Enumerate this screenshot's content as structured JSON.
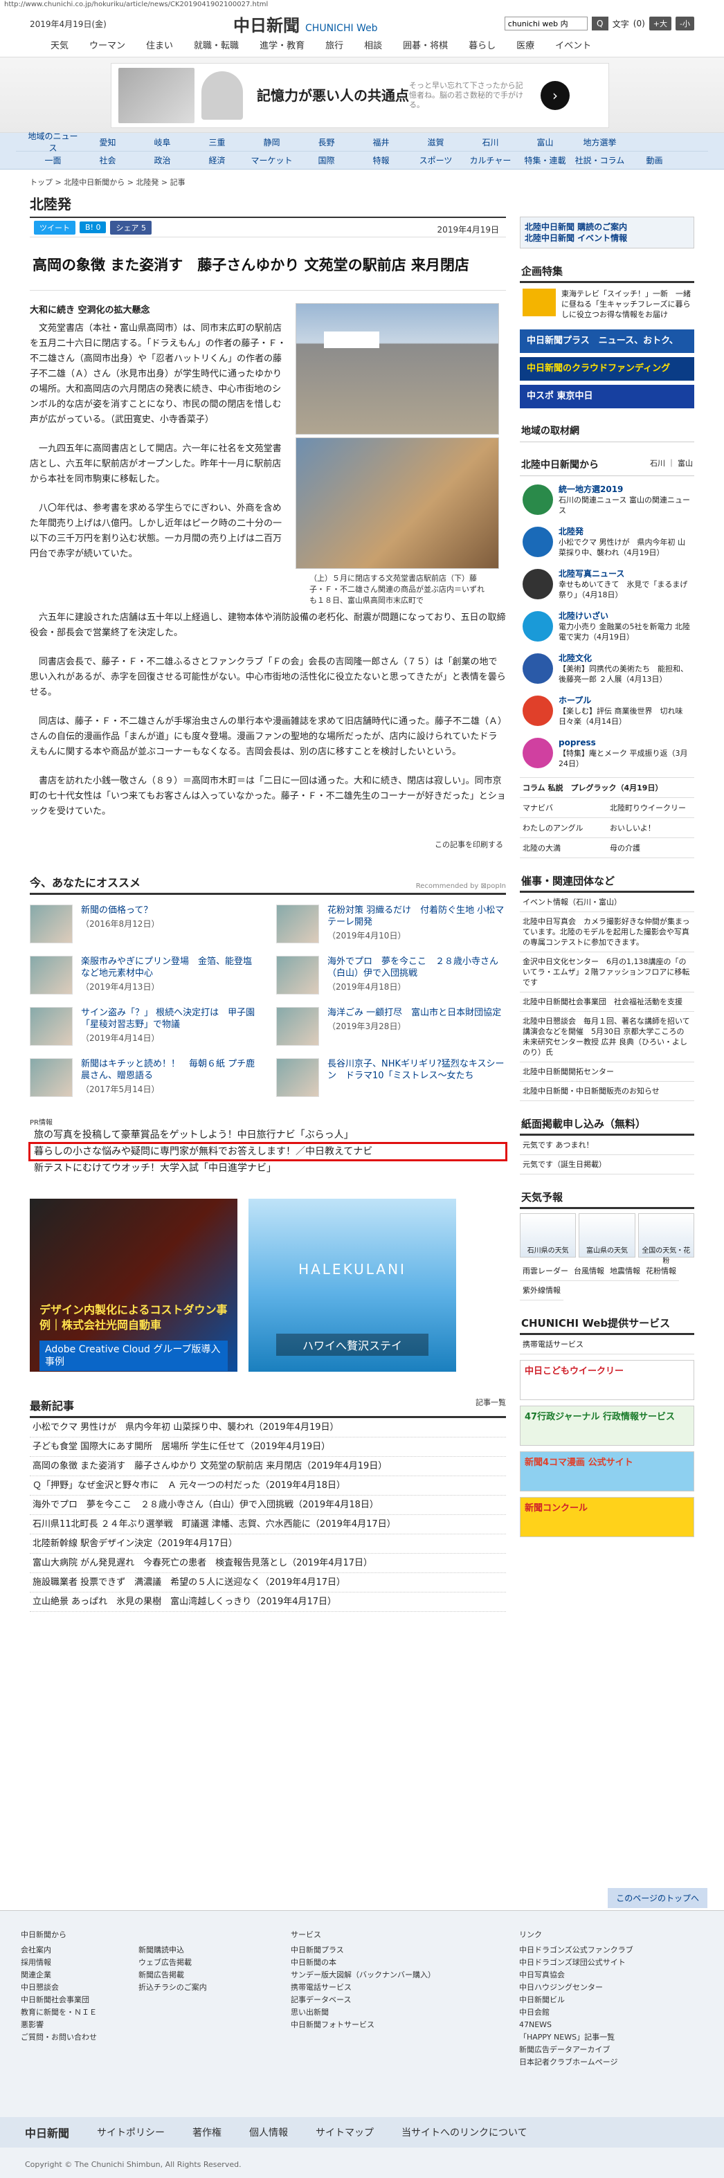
{
  "url": "http://www.chunichi.co.jp/hokuriku/article/news/CK2019041902100027.html",
  "header": {
    "date": "2019年4月19日(金)",
    "logo": "中日新聞",
    "logo_sub": "CHUNICHI Web",
    "search_value": "chunichi web 内",
    "search_icon": "Q",
    "font_label": "文字",
    "font_size_label": "(0)",
    "font_plus": "+大",
    "font_minus": "-小"
  },
  "topnav": [
    "天気",
    "ウーマン",
    "住まい",
    "就職・転職",
    "進学・教育",
    "旅行",
    "相談",
    "囲碁・将棋",
    "暮らし",
    "医療",
    "イベント"
  ],
  "ad_top": {
    "title": "記憶力が悪い人の共通点",
    "sub": "そっと早い忘れて下さったから記憶者ね。脳の若さ数秘的で手がける。"
  },
  "catnav_row1": [
    "地域のニュース",
    "愛知",
    "岐阜",
    "三重",
    "静岡",
    "長野",
    "福井",
    "滋賀",
    "石川",
    "富山",
    "地方選挙"
  ],
  "catnav_row2": [
    "一面",
    "社会",
    "政治",
    "経済",
    "マーケット",
    "国際",
    "特報",
    "スポーツ",
    "カルチャー",
    "特集・連載",
    "社説・コラム",
    "動画"
  ],
  "breadcrumb": "トップ > 北陸中日新聞から > 北陸発 > 記事",
  "section_title": "北陸発",
  "social": {
    "tweet": "ツイート",
    "hatena": "B! 0",
    "share": "シェア 5",
    "pub_date": "2019年4月19日"
  },
  "headline": "高岡の象徴 また姿消す　藤子さんゆかり 文苑堂の駅前店 来月閉店",
  "article": {
    "sub": "大和に続き 空洞化の拡大懸念",
    "p1": "文苑堂書店（本社・富山県高岡市）は、同市末広町の駅前店を五月二十六日に閉店する。「ドラえもん」の作者の藤子・Ｆ・不二雄さん（高岡市出身）や「忍者ハットリくん」の作者の藤子不二雄（Ａ）さん（氷見市出身）が学生時代に通ったゆかりの場所。大和高岡店の六月閉店の発表に続き、中心市街地のシンボル的な店が姿を消すことになり、市民の間の閉店を惜しむ声が広がっている。（武田寛史、小寺香菜子）",
    "p2": "一九四五年に高岡書店として開店。六一年に社名を文苑堂書店とし、六五年に駅前店がオープンした。昨年十一月に駅前店から本社を同市駒東に移転した。",
    "p3": "八〇年代は、参考書を求める学生らでにぎわい、外商を含めた年間売り上げは八億円。しかし近年はピーク時の二十分の一以下の三千万円を割り込む状態。一カ月間の売り上げは二百万円台で赤字が続いていた。",
    "caption": "（上）５月に閉店する文苑堂書店駅前店（下）藤子・Ｆ・不二雄さん関連の商品が並ぶ店内＝いずれも１８日、富山県高岡市末広町で",
    "p4": "六五年に建設された店舗は五十年以上経過し、建物本体や消防設備の老朽化、耐震が問題になっており、五日の取締役会・部長会で営業終了を決定した。",
    "p5": "同書店会長で、藤子・Ｆ・不二雄ふるさとファンクラブ「Ｆの会」会長の吉岡隆一郎さん（７５）は「創業の地で思い入れがあるが、赤字を回復させる可能性がない。中心市街地の活性化に役立たないと思ってきたが」と表情を曇らせる。",
    "p6": "同店は、藤子・Ｆ・不二雄さんが手塚治虫さんの単行本や漫画雑誌を求めて旧店舗時代に通った。藤子不二雄（Ａ）さんの自伝的漫画作品「まんが道」にも度々登場。漫画ファンの聖地的な場所だったが、店内に設けられていたドラえもんに関する本や商品が並ぶコーナーもなくなる。吉岡会長は、別の店に移すことを検討したいという。",
    "p7": "書店を訪れた小銭一敬さん（８９）＝高岡市木町＝は「二日に一回は通った。大和に続き、閉店は寂しい」。同市京町の七十代女性は「いつ来てもお客さんは入っていなかった。藤子・Ｆ・不二雄先生のコーナーが好きだった」とショックを受けていた。",
    "print": "この記事を印刷する"
  },
  "recommend": {
    "title": "今、あなたにオススメ",
    "by": "Recommended by ⊠popIn",
    "items": [
      {
        "title": "新聞の価格って？",
        "date": "（2016年8月12日）"
      },
      {
        "title": "花粉対策 羽織るだけ　付着防ぐ生地 小松マテーレ開発",
        "date": "（2019年4月10日）"
      },
      {
        "title": "楽服市みやぎにプリン登場　金箔、能登塩など地元素材中心",
        "date": "（2019年4月13日）"
      },
      {
        "title": "海外でプロ　夢を今ここ　２８歳小寺さん（白山）伊で入団挑戦",
        "date": "（2019年4月18日）"
      },
      {
        "title": "サイン盗み「？」 根続へ決定打は　甲子園「星稜対習志野」で物議",
        "date": "（2019年4月14日）"
      },
      {
        "title": "海洋ごみ 一顧打尽　富山市と日本財団協定",
        "date": "（2019年3月28日）"
      },
      {
        "title": "新聞はキチッと読め！！　毎朝６紙 プチ鹿晨さん、贈恩語る",
        "date": "（2017年5月14日）"
      },
      {
        "title": "長谷川京子、NHKギリギリ?猛烈なキスシーン　ドラマ10「ミストレス～女たち",
        "date": ""
      }
    ]
  },
  "pr": {
    "label": "PR情報",
    "items": [
      "旅の写真を投稿して豪華賞品をゲットしよう！中日旅行ナビ「ぶらっ人」",
      "暮らしの小さな悩みや疑問に専門家が無料でお答えします！／中日教えてナビ",
      "新テストにむけてウオッチ！大学入試「中日進学ナビ」"
    ]
  },
  "ad_adobe": {
    "t1": "デザイン内製化によるコストダウン事例｜株式会社光岡自動車",
    "t2": "Adobe Creative Cloud グループ版導入事例"
  },
  "ad_hawaii": {
    "t1": "HALEKULANI",
    "t2": "ハワイへ贅沢ステイ"
  },
  "latest": {
    "title": "最新記事",
    "link": "記事一覧",
    "items": [
      "小松でクマ 男性けが　県内今年初 山菜採り中、襲われ（2019年4月19日）",
      "子ども食堂 国際大にあす開所　居場所 学生に任せて（2019年4月19日）",
      "高岡の象徴 また姿消す　藤子さんゆかり 文苑堂の駅前店 来月閉店（2019年4月19日）",
      "Ｑ「押野」なぜ金沢と野々市に　Ａ 元々一つの村だった（2019年4月18日）",
      "海外でプロ　夢を今ここ　２８歳小寺さん（白山）伊で入団挑戦（2019年4月18日）",
      "石川県11北町長 ２４年ぶり選挙戦　町議選 津幡、志賀、穴水西能に（2019年4月17日）",
      "北陸新幹線 駅舎デザイン決定（2019年4月17日）",
      "富山大病院 がん発見遅れ　今春死亡の患者　検査報告見落とし（2019年4月17日）",
      "施設職業者 投票できず　满濃議　希望の５人に送迎なく（2019年4月17日）",
      "立山絶景 あっぱれ　氷見の果樹　富山湾越しくっきり（2019年4月17日）"
    ]
  },
  "side": {
    "subscribe": "北陸中日新聞 購読のご案内",
    "event": "北陸中日新聞 イベント情報",
    "feature_title": "企画特集",
    "feature_item": "東海テレビ「スイッチ！」一新　一緒に昼ねる「生キャッチフレーズに暮らしに役立つお得な情報をお届け",
    "bar1": "中日新聞プラス　ニュース、おトク、",
    "bar2": "中日新聞のクラウドファンディング",
    "bar3": "中スポ 東京中日",
    "local_title": "地域の取材網",
    "from_title": "北陸中日新聞から",
    "from_tabs": "石川 ｜ 富山",
    "news": [
      {
        "head": "統一地方選2019",
        "body": "石川の関連ニュース\n富山の関連ニュース"
      },
      {
        "head": "北陸発",
        "body": "小松でクマ 男性けが　県内今年初 山菜採り中、襲われ（4月19日）"
      },
      {
        "head": "北陸写真ニュース",
        "body": "幸せもめいてきて　氷見で「まるまげ祭り」（4月18日）"
      },
      {
        "head": "北陸けいざい",
        "body": "電力小売り 金融業の5社を新電力 北陸電で実力（4月19日）"
      },
      {
        "head": "北陸文化",
        "body": "【美術】同携代の美術たち　能担和、後藤亮一郎 ２人展（4月13日）"
      },
      {
        "head": "ホープル",
        "body": "【楽しむ】評伝 商業後世界　切れ味 日々楽（4月14日）"
      },
      {
        "head": "popress",
        "body": "【特集】庵とメーク 平成振り返（3月24日）"
      }
    ],
    "col_title": "コラム 私説　プレグラック（4月19日）",
    "cols": [
      "マナビバ",
      "北陸町りウイークリー",
      "わたしのアングル",
      "おいしいよ！",
      "北陸の大満",
      "母の介護"
    ],
    "company_title": "催事・関連団体など",
    "company": [
      "イベント情報（石川・富山）",
      "北陸中日写真会　カメラ撮影好きな仲間が集まっています。北陸のモデルを起用した撮影会や写真の専属コンテストに参加できます。",
      "金沢中日文化センター　6月の1,138講座の「のいてラ・エムザ」２階ファッションフロアに移転です",
      "北陸中日新聞社会事業団　社会福祉活動を支援",
      "北陸中日懇談会　毎月１回、著名な講師を招いて講演会などを開催　5月30日 京都大学こころの未来研究センター教授 広井 良典（ひろい・よしのり）氏",
      "北陸中日新聞開拓センター",
      "北陸中日新聞・中日新聞販売のお知らせ"
    ],
    "apply_title": "紙面掲載申し込み（無料）",
    "apply": [
      "元気です あつまれ！",
      "元気です（誕生日掲載）"
    ],
    "weather_title": "天気予報",
    "weather": [
      "石川県の天気",
      "富山県の天気",
      "全国の天気・花粉"
    ],
    "weather_links": [
      "雨雲レーダー",
      "台風情報",
      "地震情報",
      "花粉情報",
      "紫外線情報"
    ],
    "service_title": "CHUNICHI Web提供サービス",
    "service_link": "携帯電話サービス",
    "sb1": "中日こどもウイークリー",
    "sb2": "47行政ジャーナル 行政情報サービス",
    "sb3": "新聞4コマ漫画 公式サイト",
    "sb4": "新聞コンクール"
  },
  "pagetop": "このページのトップへ",
  "footer": {
    "c1_title": "中日新聞から",
    "c1": [
      "会社案内",
      "採用情報",
      "関連企業",
      "中日懇談会",
      "中日新聞社会事業団",
      "教育に新聞を・ＮＩＥ",
      "悪影響",
      "ご質問・お問い合わせ"
    ],
    "c2": [
      "新聞購読申込",
      "ウェブ広告掲載",
      "新聞広告掲載",
      "折込チラシのご案内"
    ],
    "c3_title": "サービス",
    "c3": [
      "中日新聞プラス",
      "中日新聞の本",
      "サンデー版大図解（バックナンバー購入）",
      "携帯電話サービス",
      "記事データベース",
      "思い出新聞",
      "中日新聞フォトサービス"
    ],
    "c4_title": "リンク",
    "c4": [
      "中日ドラゴンズ公式ファンクラブ",
      "中日ドラゴンズ球団公式サイト",
      "中日写真協会",
      "中日ハウジングセンター",
      "中日新聞ビル",
      "中日会館",
      "47NEWS",
      "「HAPPY NEWS」記事一覧",
      "新聞広告データアーカイブ",
      "日本記者クラブホームページ"
    ],
    "bar": [
      "中日新聞",
      "サイトポリシー",
      "著作権",
      "個人情報",
      "サイトマップ",
      "当サイトへのリンクについて"
    ],
    "copyright": "Copyright © The Chunichi Shimbun, All Rights Reserved."
  }
}
